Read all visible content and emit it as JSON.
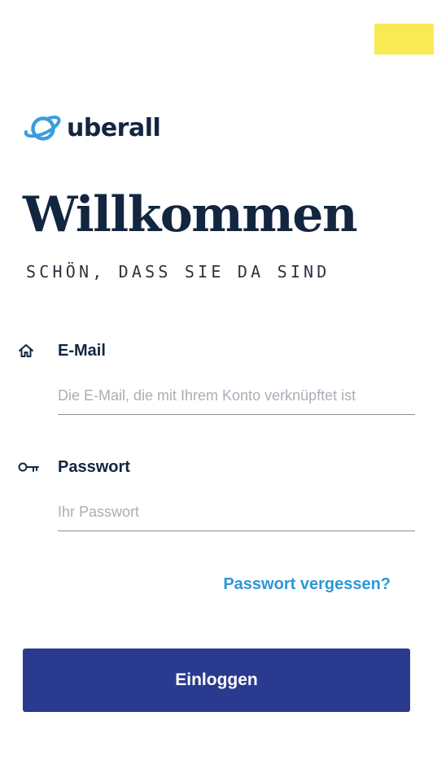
{
  "logo": {
    "text": "uberall",
    "icon": "planet-ring-icon"
  },
  "header": {
    "title": "Willkommen",
    "subtitle": "SCHÖN, DASS SIE DA SIND"
  },
  "form": {
    "email": {
      "label": "E-Mail",
      "icon": "home-icon",
      "placeholder": "Die E-Mail, die mit Ihrem Konto verknüpftet ist",
      "value": ""
    },
    "password": {
      "label": "Passwort",
      "icon": "key-icon",
      "placeholder": "Ihr Passwort",
      "value": ""
    },
    "forgot_label": "Passwort vergessen?",
    "submit_label": "Einloggen"
  },
  "colors": {
    "primary": "#2a3a8f",
    "link": "#2f96d8",
    "brand": "#3a9ddf",
    "text": "#12263f",
    "corner_flag": "#f7ea55"
  }
}
